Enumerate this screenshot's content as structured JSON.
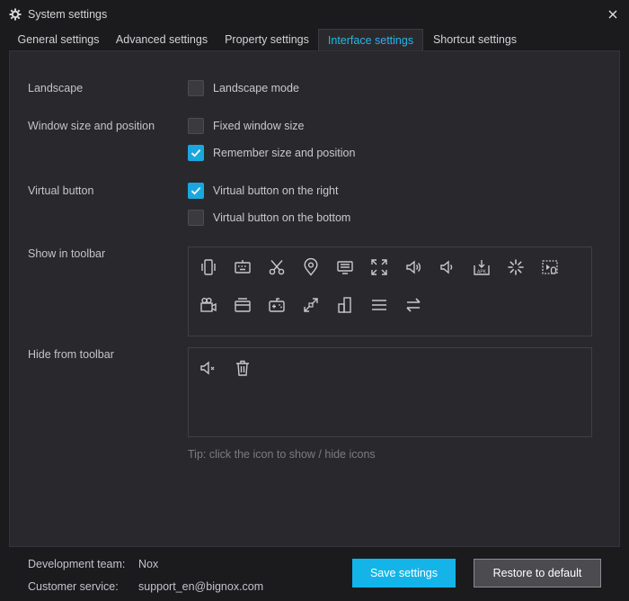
{
  "window": {
    "title": "System settings",
    "close_icon": "close-icon"
  },
  "tabs": [
    {
      "label": "General settings"
    },
    {
      "label": "Advanced settings"
    },
    {
      "label": "Property settings"
    },
    {
      "label": "Interface settings",
      "active": true
    },
    {
      "label": "Shortcut settings"
    }
  ],
  "settings": {
    "landscape": {
      "label": "Landscape",
      "options": [
        {
          "label": "Landscape mode",
          "checked": false
        }
      ]
    },
    "window": {
      "label": "Window size and position",
      "options": [
        {
          "label": "Fixed window size",
          "checked": false
        },
        {
          "label": "Remember size and position",
          "checked": true
        }
      ]
    },
    "virtual": {
      "label": "Virtual button",
      "options": [
        {
          "label": "Virtual button on the right",
          "checked": true
        },
        {
          "label": "Virtual button on the bottom",
          "checked": false
        }
      ]
    }
  },
  "toolbar": {
    "show_label": "Show in toolbar",
    "hide_label": "Hide from toolbar",
    "shown_icons": [
      "shake-phone-icon",
      "keyboard-icon",
      "scissors-icon",
      "location-icon",
      "multi-screen-icon",
      "fullscreen-icon",
      "volume-up-icon",
      "volume-down-icon",
      "apk-install-icon",
      "loading-icon",
      "macro-record-icon",
      "video-record-icon",
      "screen-share-icon",
      "gamepad-icon",
      "resize-icon",
      "bar-chart-icon",
      "menu-icon",
      "sync-icon"
    ],
    "hidden_icons": [
      "mute-icon",
      "trash-icon"
    ],
    "tip": "Tip: click the icon to show / hide icons"
  },
  "footer": {
    "dev_label": "Development team:",
    "dev_value": "Nox",
    "service_label": "Customer service:",
    "service_value": "support_en@bignox.com",
    "save_button": "Save settings",
    "restore_button": "Restore to default"
  },
  "colors": {
    "accent": "#15b4e8",
    "background": "#1b1b1e",
    "panel": "#29292d"
  }
}
